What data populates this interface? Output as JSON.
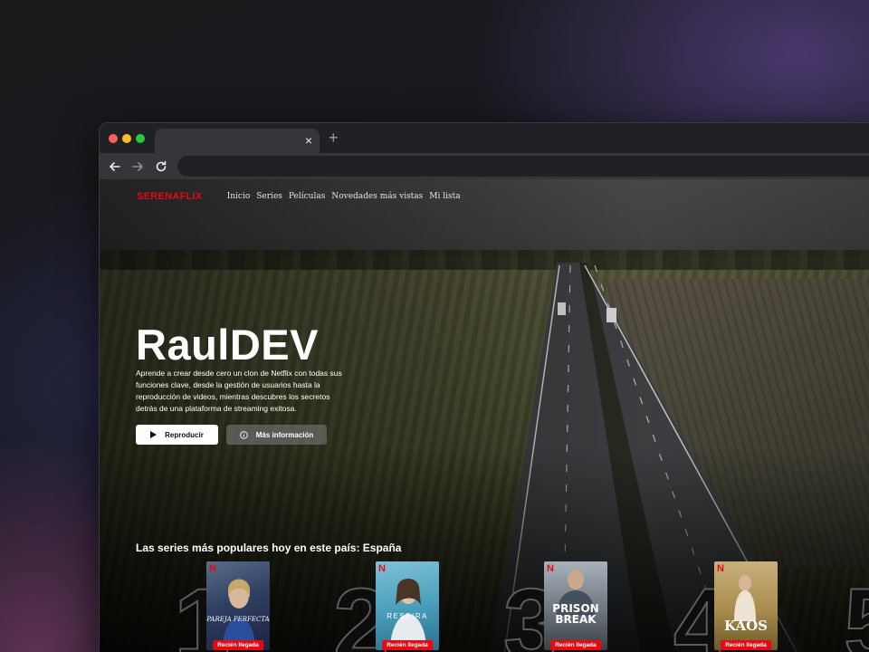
{
  "browser": {
    "tab_close": "×",
    "new_tab": "+"
  },
  "app": {
    "logo": "SERENAFLIX",
    "nav": [
      "Inicio",
      "Series",
      "Películas",
      "Novedades más vistas",
      "Mi lista"
    ]
  },
  "hero": {
    "title": "RaulDEV",
    "description": "Aprende a crear desde cero un clon de Netflix con todas sus funciones clave, desde la gestión de usuarios hasta la reproducción de videos, mientras descubres los secretos detrás de una plataforma de streaming exitosa.",
    "play_label": "Reproducir",
    "info_label": "Más información"
  },
  "top10": {
    "title": "Las series más populares hoy en este país: España",
    "items": [
      {
        "rank": "1",
        "poster_title": "PAREJA PERFECTA",
        "badge": "Recién llegada",
        "brand": "N"
      },
      {
        "rank": "2",
        "poster_title": "RESPIRA",
        "badge": "Recién llegada",
        "brand": "N"
      },
      {
        "rank": "3",
        "poster_title": "PRISON BREAK",
        "badge": "Recién llegada",
        "brand": "N"
      },
      {
        "rank": "4",
        "poster_title": "KAOS",
        "badge": "Recién llegada",
        "brand": "N"
      },
      {
        "rank": "5"
      }
    ]
  },
  "colors": {
    "brand": "#e50914",
    "window_bg": "#202124",
    "toolbar_bg": "#35363a"
  },
  "icons": {
    "back": "arrow-left-icon",
    "forward": "arrow-right-icon",
    "reload": "reload-icon",
    "play": "play-icon",
    "info": "info-icon"
  }
}
